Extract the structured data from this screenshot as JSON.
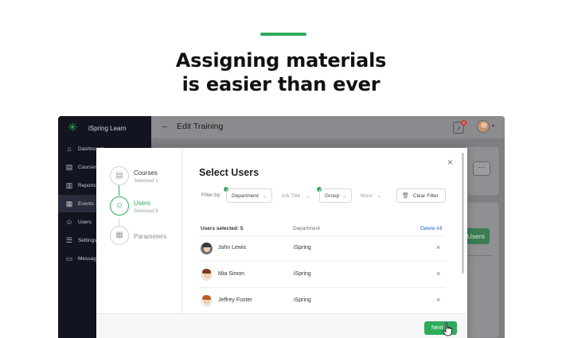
{
  "headline": {
    "line1": "Assigning materials",
    "line2": "is easier than ever"
  },
  "colors": {
    "accent": "#2fab5c",
    "sidebar": "#121420",
    "link": "#2867c9",
    "badge": "#d9342b"
  },
  "app": {
    "brand": "iSpring Learn",
    "brand_icon": "ispring-logo-icon",
    "page_title": "Edit Training",
    "notification_count": "8",
    "sidebar": [
      {
        "label": "Dashboard",
        "icon": "home-icon"
      },
      {
        "label": "Courses",
        "icon": "courses-icon"
      },
      {
        "label": "Reports",
        "icon": "reports-icon"
      },
      {
        "label": "Events",
        "icon": "calendar-icon"
      },
      {
        "label": "Users",
        "icon": "users-icon"
      },
      {
        "label": "Settings",
        "icon": "sliders-icon"
      },
      {
        "label": "Messages",
        "icon": "message-icon"
      }
    ],
    "background_button": "Users",
    "more_label": "···"
  },
  "modal": {
    "steps": [
      {
        "title": "Courses",
        "subtitle": "Selected 1",
        "icon": "document-icon"
      },
      {
        "title": "Users",
        "subtitle": "Selected 8",
        "icon": "users-icon"
      },
      {
        "title": "Parameters",
        "subtitle": "",
        "icon": "calendar-icon"
      }
    ],
    "title": "Select Users",
    "filter_label": "Filter by:",
    "filters": [
      {
        "label": "Department",
        "active": true
      },
      {
        "label": "Job Title",
        "active": false
      },
      {
        "label": "Group",
        "active": true
      },
      {
        "label": "More",
        "active": false
      }
    ],
    "clear_filter": "Clear Filter",
    "table": {
      "selected_label": "Users selected: 5",
      "department_header": "Department",
      "delete_all": "Delete All",
      "rows": [
        {
          "name": "John Lewis",
          "department": "iSpring"
        },
        {
          "name": "Mia Simon",
          "department": "iSpring"
        },
        {
          "name": "Jeffrey Foster",
          "department": "iSpring"
        }
      ]
    },
    "next_label": "Next"
  }
}
